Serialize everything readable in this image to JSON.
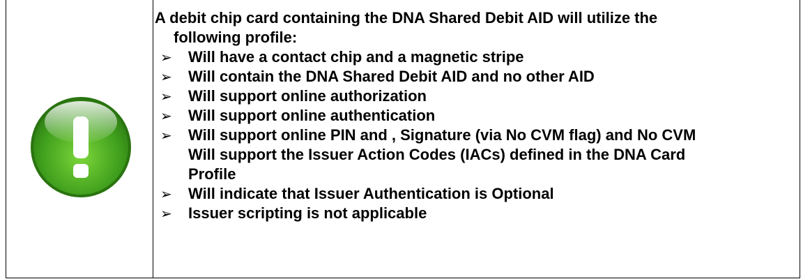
{
  "note": {
    "icon": "exclamation-icon",
    "icon_color": "#3a9a1a",
    "intro_line1": "A debit chip card containing the DNA Shared Debit AID will utilize the",
    "intro_line2": "following profile:",
    "bullet_glyph": "➢",
    "items": [
      {
        "lines": [
          "Will have a contact chip and a magnetic stripe"
        ]
      },
      {
        "lines": [
          "Will contain the DNA Shared Debit AID and no other AID"
        ]
      },
      {
        "lines": [
          "Will support online authorization"
        ]
      },
      {
        "lines": [
          "Will support online authentication"
        ]
      },
      {
        "lines": [
          "Will support online PIN and , Signature (via No CVM flag) and No CVM",
          "Will support the Issuer Action Codes (IACs) defined in the DNA Card",
          "Profile"
        ]
      },
      {
        "lines": [
          "Will indicate that Issuer Authentication is Optional"
        ]
      },
      {
        "lines": [
          "Issuer scripting is not applicable"
        ]
      }
    ]
  }
}
